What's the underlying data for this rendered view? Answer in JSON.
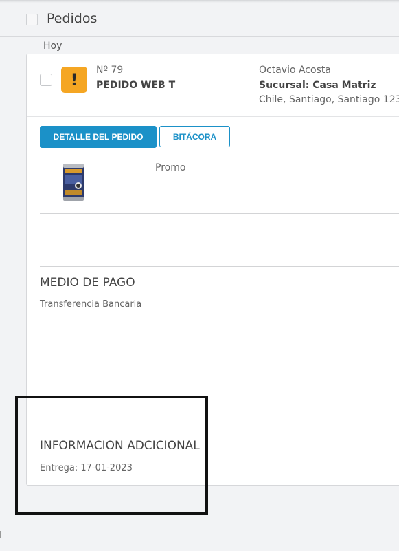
{
  "header": {
    "title": "Pedidos"
  },
  "group": {
    "label": "Hoy"
  },
  "order": {
    "number": "Nº 79",
    "name": "PEDIDO WEB T",
    "customer": "Octavio Acosta",
    "branch": "Sucursal: Casa Matriz",
    "address": "Chile, Santiago, Santiago 123",
    "status_icon": "warning-icon",
    "status_color": "#f5a623"
  },
  "actions": {
    "detail_label": "DETALLE DEL PEDIDO",
    "log_label": "BITÁCORA"
  },
  "items": [
    {
      "name": "Promo",
      "image": "beer-can"
    }
  ],
  "payment": {
    "title": "MEDIO DE PAGO",
    "value": "Transferencia Bancaria"
  },
  "additional": {
    "title": "INFORMACION ADCICIONAL",
    "value": "Entrega: 17-01-2023"
  },
  "colors": {
    "accent": "#1b91c8",
    "warning": "#f5a623"
  }
}
